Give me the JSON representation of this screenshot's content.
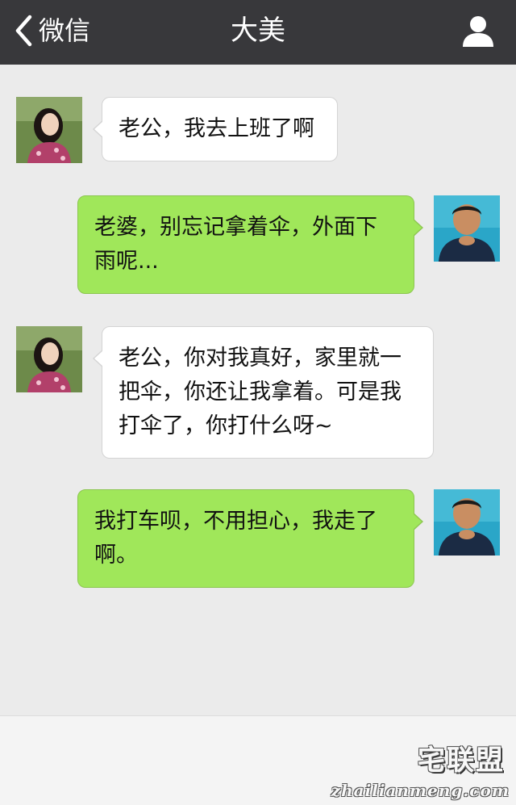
{
  "header": {
    "back_label": "微信",
    "title": "大美",
    "back_icon": "chevron-left-icon",
    "profile_icon": "person-icon"
  },
  "colors": {
    "header_bg": "#38383b",
    "chat_bg": "#ebebeb",
    "incoming_bubble": "#ffffff",
    "outgoing_bubble": "#a0e75a"
  },
  "messages": [
    {
      "sender": "大美",
      "direction": "in",
      "lines": [
        "老公，我去上班了啊"
      ]
    },
    {
      "sender": "me",
      "direction": "out",
      "lines": [
        "老婆，别忘记拿着伞，外面下",
        "雨呢..."
      ]
    },
    {
      "sender": "大美",
      "direction": "in",
      "lines": [
        "老公，你对我真好，家里就一",
        "把伞，你还让我拿着。可是我",
        "打伞了，你打什么呀~"
      ]
    },
    {
      "sender": "me",
      "direction": "out",
      "lines": [
        "我打车呗，不用担心，我走了",
        "啊。"
      ]
    }
  ],
  "watermark": {
    "logo": "宅联盟",
    "url": "zhailianmeng.com"
  }
}
